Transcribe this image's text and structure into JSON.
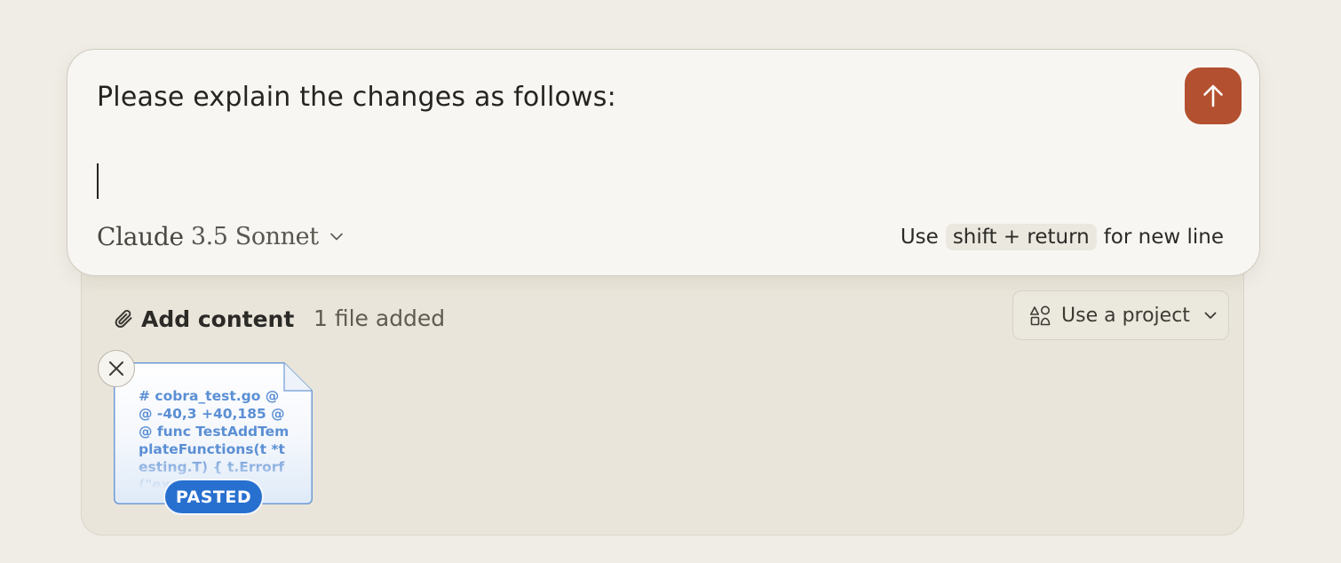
{
  "composer": {
    "prompt": "Please explain the changes as follows:",
    "model": {
      "brand": "Claude",
      "version": "3.5 Sonnet"
    },
    "hint": {
      "prefix": "Use",
      "key": "shift + return",
      "suffix": "for new line"
    },
    "send_icon": "arrow-up-icon",
    "send_color": "#b3502f"
  },
  "attachments": {
    "add_content_label": "Add content",
    "files_count": "1 file added",
    "project_label": "Use a project",
    "files": [
      {
        "preview": "# cobra_test.go @@ -40,3 +40,185 @@ func TestAddTemplateFunctions(t *testing.T) { t.Errorf(\"expected",
        "badge": "PASTED"
      }
    ]
  },
  "colors": {
    "background": "#f0ede6",
    "tray": "#e9e5da",
    "badge": "#2870cf",
    "file_text": "#5b8fd4"
  }
}
